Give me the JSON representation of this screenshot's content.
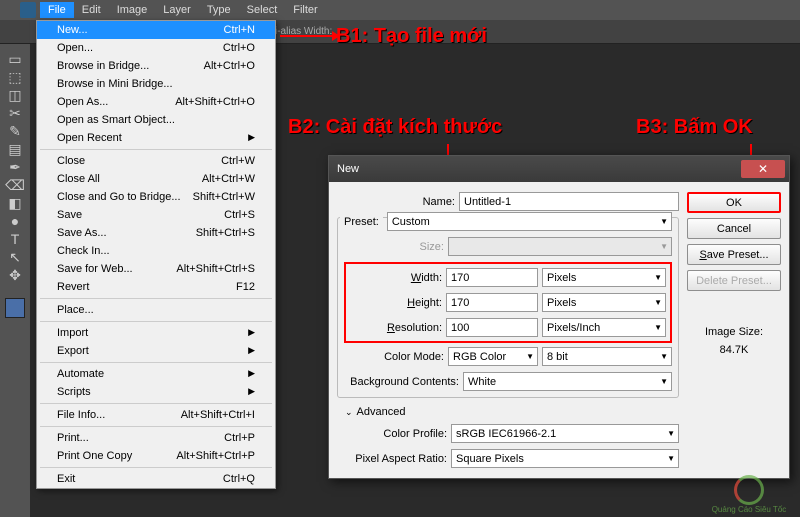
{
  "menubar": [
    "File",
    "Edit",
    "Image",
    "Layer",
    "Type",
    "Select",
    "Filter"
  ],
  "optionsbar_hint": "Anti-alias  Width:",
  "file_menu": [
    {
      "label": "New...",
      "sc": "Ctrl+N",
      "hl": true
    },
    {
      "label": "Open...",
      "sc": "Ctrl+O"
    },
    {
      "label": "Browse in Bridge...",
      "sc": "Alt+Ctrl+O"
    },
    {
      "label": "Browse in Mini Bridge..."
    },
    {
      "label": "Open As...",
      "sc": "Alt+Shift+Ctrl+O"
    },
    {
      "label": "Open as Smart Object..."
    },
    {
      "label": "Open Recent",
      "sub": true
    },
    {
      "sep": true
    },
    {
      "label": "Close",
      "sc": "Ctrl+W"
    },
    {
      "label": "Close All",
      "sc": "Alt+Ctrl+W"
    },
    {
      "label": "Close and Go to Bridge...",
      "sc": "Shift+Ctrl+W"
    },
    {
      "label": "Save",
      "sc": "Ctrl+S"
    },
    {
      "label": "Save As...",
      "sc": "Shift+Ctrl+S"
    },
    {
      "label": "Check In..."
    },
    {
      "label": "Save for Web...",
      "sc": "Alt+Shift+Ctrl+S"
    },
    {
      "label": "Revert",
      "sc": "F12"
    },
    {
      "sep": true
    },
    {
      "label": "Place..."
    },
    {
      "sep": true
    },
    {
      "label": "Import",
      "sub": true
    },
    {
      "label": "Export",
      "sub": true
    },
    {
      "sep": true
    },
    {
      "label": "Automate",
      "sub": true
    },
    {
      "label": "Scripts",
      "sub": true
    },
    {
      "sep": true
    },
    {
      "label": "File Info...",
      "sc": "Alt+Shift+Ctrl+I"
    },
    {
      "sep": true
    },
    {
      "label": "Print...",
      "sc": "Ctrl+P"
    },
    {
      "label": "Print One Copy",
      "sc": "Alt+Shift+Ctrl+P"
    },
    {
      "sep": true
    },
    {
      "label": "Exit",
      "sc": "Ctrl+Q"
    }
  ],
  "annotations": {
    "b1": "B1: Tạo file mới",
    "b2": "B2: Cài đặt kích thước",
    "b3": "B3: Bấm OK"
  },
  "dialog": {
    "title": "New",
    "name_lbl": "Name:",
    "name_val": "Untitled-1",
    "preset_lbl": "Preset:",
    "preset_val": "Custom",
    "size_lbl": "Size:",
    "width_lbl": "Width:",
    "width_val": "170",
    "width_unit": "Pixels",
    "height_lbl": "Height:",
    "height_val": "170",
    "height_unit": "Pixels",
    "res_lbl": "Resolution:",
    "res_val": "100",
    "res_unit": "Pixels/Inch",
    "cm_lbl": "Color Mode:",
    "cm_val": "RGB Color",
    "cm_depth": "8 bit",
    "bg_lbl": "Background Contents:",
    "bg_val": "White",
    "adv": "Advanced",
    "cp_lbl": "Color Profile:",
    "cp_val": "sRGB IEC61966-2.1",
    "par_lbl": "Pixel Aspect Ratio:",
    "par_val": "Square Pixels",
    "ok": "OK",
    "cancel": "Cancel",
    "save_preset": "Save Preset...",
    "delete_preset": "Delete Preset...",
    "img_size_lbl": "Image Size:",
    "img_size_val": "84.7K"
  },
  "tools": [
    "▭",
    "⬚",
    "◫",
    "✂",
    "✎",
    "▤",
    "✒",
    "⌫",
    "◧",
    "●",
    "T",
    "↖",
    "✥"
  ]
}
